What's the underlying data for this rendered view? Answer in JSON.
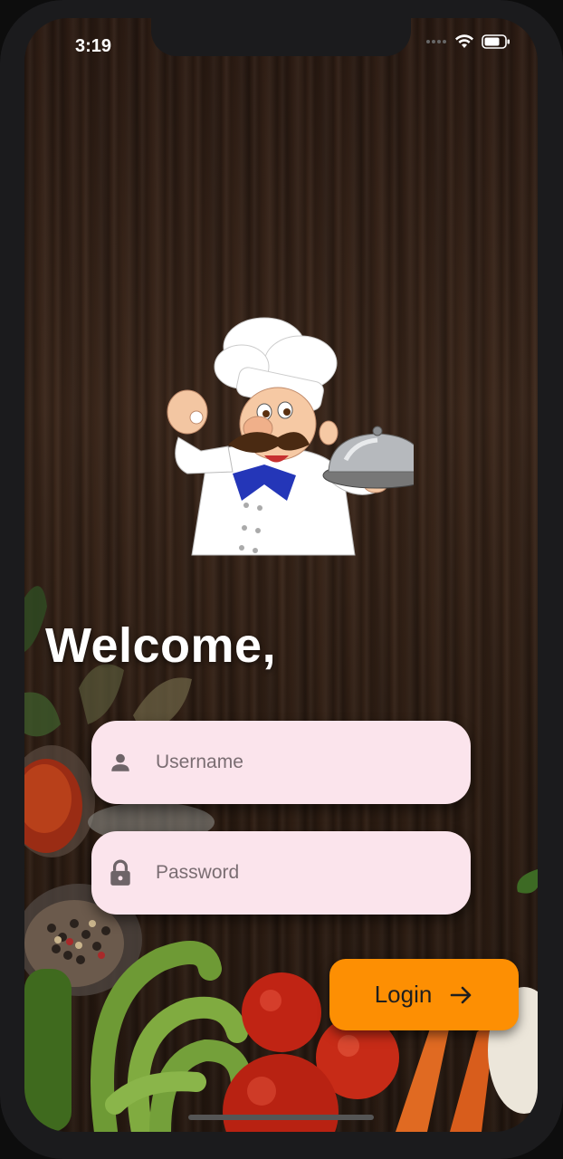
{
  "status_bar": {
    "time": "3:19"
  },
  "welcome": {
    "title": "Welcome,"
  },
  "form": {
    "username_placeholder": "Username",
    "password_placeholder": "Password"
  },
  "login_button": {
    "label": "Login"
  },
  "colors": {
    "field_bg": "#fbe4ec",
    "button_bg": "#fd8f03"
  },
  "icons": [
    "person-icon",
    "lock-icon",
    "arrow-right-icon",
    "wifi-icon",
    "battery-icon",
    "signal-icon"
  ]
}
